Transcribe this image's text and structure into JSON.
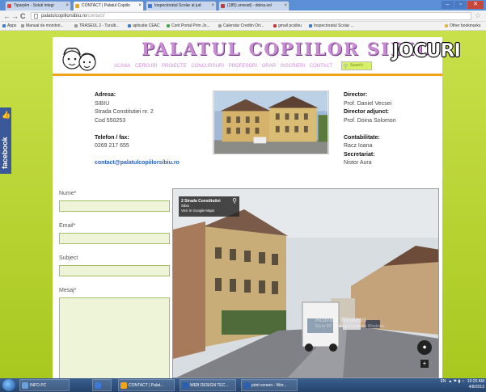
{
  "browser": {
    "tabs": [
      {
        "label": "Tiparpim - Soluti integr",
        "color": "#e3443b",
        "active": false
      },
      {
        "label": "CONTACT | Palatul Copiilo",
        "color": "#f0a41c",
        "active": true
      },
      {
        "label": "Inspectoratul Scolar al jud",
        "color": "#3d7ad6",
        "active": false
      },
      {
        "label": "(185) unread) - doina.sol",
        "color": "#c23a3a",
        "active": false
      }
    ],
    "url_domain": "palatulcopiilorsibiu.ro",
    "url_path": "/contact/",
    "bookmarks": [
      {
        "label": "Apps",
        "color": "#3d7ad6"
      },
      {
        "label": "Manual de monitori...",
        "color": "#888"
      },
      {
        "label": "TRASEUL 2 - Turulb...",
        "color": "#888"
      },
      {
        "label": "aplicatie CEAC",
        "color": "#3d7ad6"
      },
      {
        "label": "Cont Portal Prim Jo...",
        "color": "#4aa64a"
      },
      {
        "label": "Calendar Credtin Ort...",
        "color": "#888"
      },
      {
        "label": "gmail pcsibiu",
        "color": "#c23a3a"
      },
      {
        "label": "Inspectoratul Scolar ...",
        "color": "#3d7ad6"
      },
      {
        "label": "Other bookmarks",
        "color": "#e0b84a"
      }
    ]
  },
  "site": {
    "title": "PALATUL COPIILOR SIBIU",
    "jocuri": "JOCURI",
    "menu": [
      "ACASA",
      "CERCURI",
      "PROIECTE",
      "CONCURSURI",
      "PROFESORI",
      "ORAR",
      "INSCRIERI",
      "CONTACT"
    ],
    "search_placeholder": "Search"
  },
  "contact": {
    "address_label": "Adresa:",
    "address_lines": [
      "SIBIU",
      "Strada Constitutiei nr. 2",
      "Cod 550253"
    ],
    "phone_label": "Telefon / fax:",
    "phone": "0269 217 655",
    "email": "contact@palatulcopiilorsibiu.ro",
    "director_label": "Director:",
    "director": "Prof. Daniel Vecsei",
    "deputy_label": "Director adjunct:",
    "deputy": "Prof. Doina Solomon",
    "accounting_label": "Contabilitate:",
    "accounting": "Racz Ioana",
    "secretary_label": "Secretariat:",
    "secretary": "Nistor Aura"
  },
  "form": {
    "name_label": "Nume*",
    "email_label": "Email*",
    "subject_label": "Subject",
    "message_label": "Mesaj*"
  },
  "streetview": {
    "title": "2 Strada Constitutiei",
    "subtitle": "Sibiu",
    "link": "Vezi in Google Maps"
  },
  "facebook_label": "facebook",
  "watermark": {
    "line1": "Activate Windows",
    "line2": "Go to PC settings to activate Windows."
  },
  "taskbar": {
    "items": [
      {
        "label": "INFO PC",
        "color": "#6aa0d8"
      },
      {
        "label": "",
        "color": "#3d7ad6"
      },
      {
        "label": "CONTACT | Palat...",
        "color": "#f0a41c"
      },
      {
        "label": "WEB DESIGN TEC...",
        "color": "#2b5fb0"
      },
      {
        "label": "print screen - Wor...",
        "color": "#2b5fb0"
      }
    ],
    "lang": "EN",
    "time": "10:25 AM",
    "date": "4/8/2013"
  }
}
